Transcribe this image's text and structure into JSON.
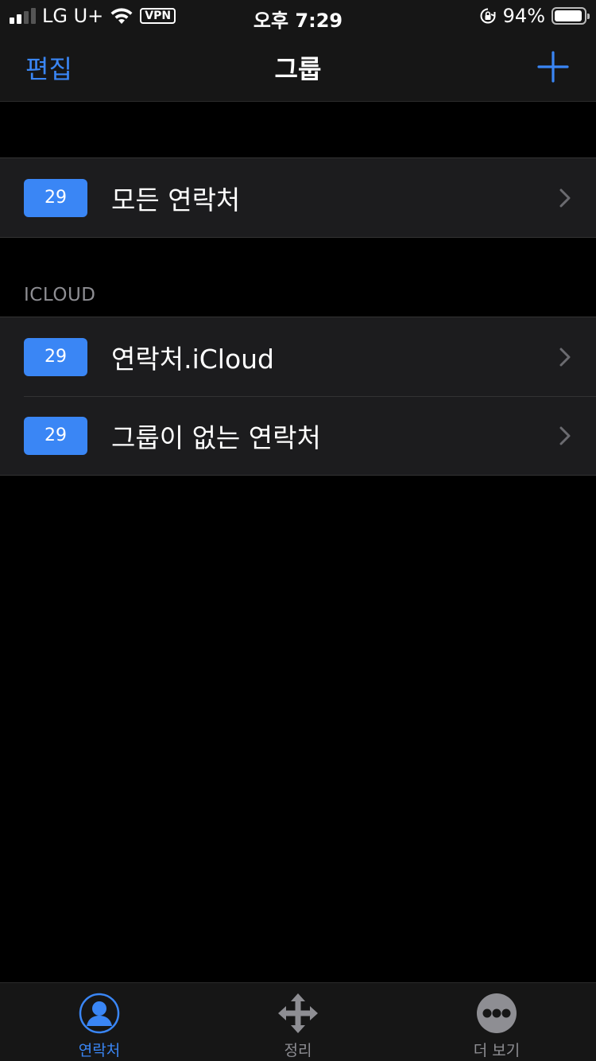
{
  "status_bar": {
    "carrier": "LG U+",
    "vpn": "VPN",
    "time": "오후 7:29",
    "battery": "94%",
    "battery_level": 0.94
  },
  "nav": {
    "edit_label": "편집",
    "title": "그룹"
  },
  "all_group": {
    "count": "29",
    "label": "모든 연락처"
  },
  "icloud_section": {
    "header": "ICLOUD",
    "rows": [
      {
        "count": "29",
        "label": "연락처.iCloud"
      },
      {
        "count": "29",
        "label": "그룹이 없는 연락처"
      }
    ]
  },
  "tabs": [
    {
      "label": "연락처",
      "active": true
    },
    {
      "label": "정리",
      "active": false
    },
    {
      "label": "더 보기",
      "active": false
    }
  ],
  "colors": {
    "accent": "#3a86f5",
    "background": "#000000",
    "cell": "#1c1c1e"
  }
}
